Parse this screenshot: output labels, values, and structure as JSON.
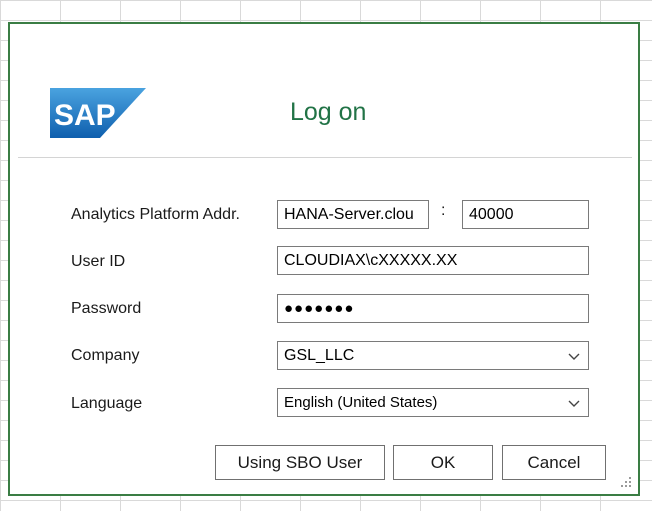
{
  "brand": {
    "logo_text": "SAP"
  },
  "dialog": {
    "title": "Log on"
  },
  "form": {
    "address": {
      "label": "Analytics Platform Addr.",
      "host": "HANA-Server.clou",
      "separator": ":",
      "port": "40000"
    },
    "user_id": {
      "label": "User ID",
      "value": "CLOUDIAX\\cXXXXX.XX"
    },
    "password": {
      "label": "Password",
      "masked_value": "●●●●●●●"
    },
    "company": {
      "label": "Company",
      "value": "GSL_LLC"
    },
    "language": {
      "label": "Language",
      "value": "English (United States)"
    }
  },
  "buttons": {
    "sbo_user": "Using SBO User",
    "ok": "OK",
    "cancel": "Cancel"
  },
  "colors": {
    "frame": "#3a7d44",
    "title": "#217346",
    "logo_blue": "#1b75bc"
  },
  "icons": [
    "sap-logo",
    "chevron-down-icon",
    "resize-grip-icon"
  ]
}
